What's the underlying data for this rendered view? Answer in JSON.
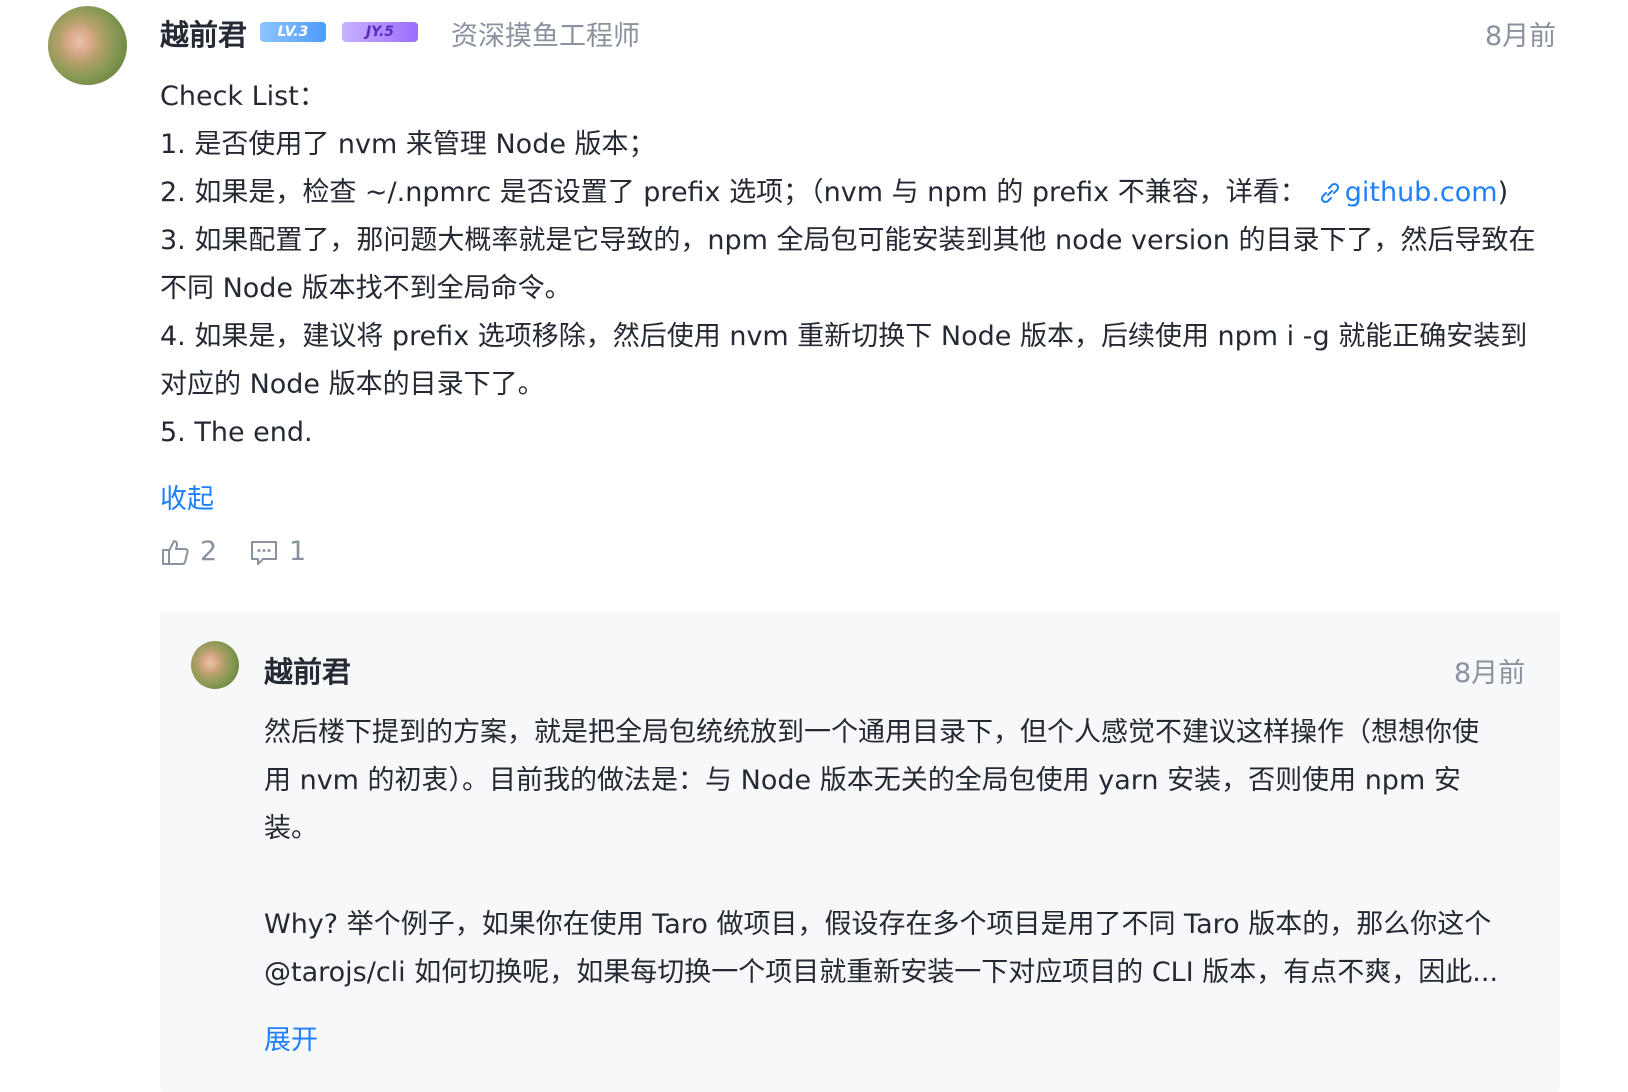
{
  "comment": {
    "author": "越前君",
    "level_badge": "LV.3",
    "jy_badge": "JY.5",
    "user_title": "资深摸鱼工程师",
    "time": "8月前",
    "lines": [
      "Check List：",
      "1. 是否使用了 nvm 来管理 Node 版本；",
      "2. 如果是，检查 ~/.npmrc 是否设置了 prefix 选项；（nvm 与 npm 的 prefix 不兼容，详看：",
      "3. 如果配置了，那问题大概率就是它导致的，npm 全局包可能安装到其他 node version 的目录下了，然后导致在",
      "不同 Node 版本找不到全局命令。",
      "4. 如果是，建议将 prefix 选项移除，然后使用 nvm 重新切换下 Node 版本，后续使用 npm i -g 就能正确安装到",
      "对应的 Node 版本的目录下了。",
      "5. The end."
    ],
    "link_text": "github.com",
    "link_suffix": ")",
    "collapse_label": "收起",
    "like_count": "2",
    "reply_count": "1"
  },
  "reply": {
    "author": "越前君",
    "time": "8月前",
    "lines": [
      "然后楼下提到的方案，就是把全局包统统放到一个通用目录下，但个人感觉不建议这样操作（想想你使",
      "用 nvm 的初衷）。目前我的做法是：与 Node 版本无关的全局包使用 yarn 安装，否则使用 npm 安",
      "装。",
      "Why? 举个例子，如果你在使用 Taro 做项目，假设存在多个项目是用了不同 Taro 版本的，那么你这个",
      "@tarojs/cli 如何切换呢，如果每切换一个项目就重新安装一下对应项目的 CLI 版本，有点不爽，因此..."
    ],
    "expand_label": "展开"
  },
  "colors": {
    "accent": "#1e80ff",
    "text": "#252933",
    "muted": "#8a919f",
    "reply_bg": "#f7f8fa"
  }
}
